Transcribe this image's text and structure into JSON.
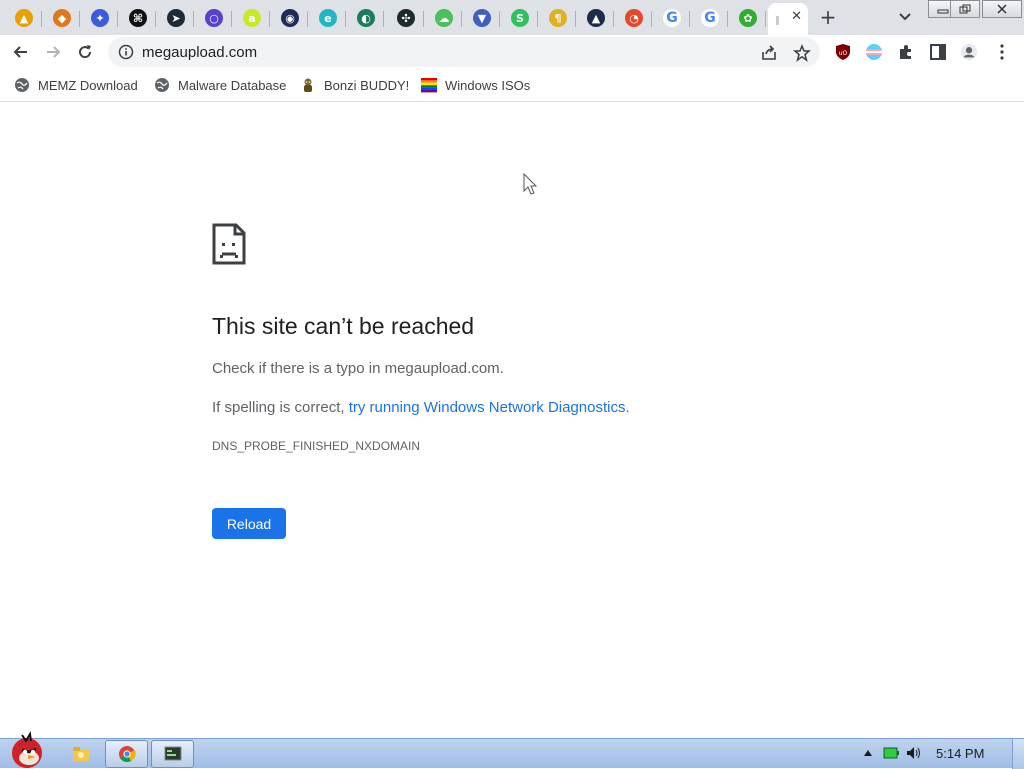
{
  "tabs": [
    {
      "icon": "rainbow-flag-icon",
      "color": "#e8a000",
      "glyph": "▲"
    },
    {
      "icon": "metamask-fox-icon",
      "color": "#e2761b",
      "glyph": "◆"
    },
    {
      "icon": "wand-icon",
      "color": "#3b5bdb",
      "glyph": "✦"
    },
    {
      "icon": "dark-hash-icon",
      "color": "#111111",
      "glyph": "⌘"
    },
    {
      "icon": "telegram-icon",
      "color": "#1f2a37",
      "glyph": "➤"
    },
    {
      "icon": "chat-bubble-icon",
      "color": "#5b3fd1",
      "glyph": "○"
    },
    {
      "icon": "letter-a-icon",
      "color": "#c6e82a",
      "glyph": "a"
    },
    {
      "icon": "orbit-icon",
      "color": "#1e2a5a",
      "glyph": "◉"
    },
    {
      "icon": "edge-icon",
      "color": "#22b5c4",
      "glyph": "e"
    },
    {
      "icon": "pac-icon",
      "color": "#1e7b5c",
      "glyph": "◐"
    },
    {
      "icon": "dots-icon",
      "color": "#1a2d2a",
      "glyph": "✣"
    },
    {
      "icon": "cloud-icon",
      "color": "#4cbf5c",
      "glyph": "☁"
    },
    {
      "icon": "bird-icon",
      "color": "#3e5fc4",
      "glyph": "▼"
    },
    {
      "icon": "green-s-icon",
      "color": "#2ec35a",
      "glyph": "S"
    },
    {
      "icon": "gold-figure-icon",
      "color": "#e0b020",
      "glyph": "¶"
    },
    {
      "icon": "compass-icon",
      "color": "#1c2b4a",
      "glyph": "▲"
    },
    {
      "icon": "red-swirl-icon",
      "color": "#e5482b",
      "glyph": "◔"
    },
    {
      "icon": "google-icon",
      "color": "#4285f4",
      "glyph": "G"
    },
    {
      "icon": "google-icon",
      "color": "#4285f4",
      "glyph": "G"
    },
    {
      "icon": "green-flower-icon",
      "color": "#2fae2f",
      "glyph": "✿"
    }
  ],
  "omnibox": {
    "url": "megaupload.com"
  },
  "bookmarks": [
    {
      "label": "MEMZ Download",
      "icon": "globe-icon"
    },
    {
      "label": "Malware Database",
      "icon": "globe-icon"
    },
    {
      "label": "Bonzi BUDDY!",
      "icon": "bonzi-icon"
    },
    {
      "label": "Windows ISOs",
      "icon": "rainbow-flag-icon"
    }
  ],
  "error": {
    "title": "This site can’t be reached",
    "line1": "Check if there is a typo in megaupload.com.",
    "line2_prefix": "If spelling is correct, ",
    "line2_link": "try running Windows Network Diagnostics",
    "line2_suffix": ".",
    "code": "DNS_PROBE_FINISHED_NXDOMAIN",
    "reload": "Reload"
  },
  "taskbar": {
    "clock": "5:14 PM"
  },
  "colors": {
    "accent": "#1a73e8",
    "tabstrip": "#dee1e6"
  }
}
